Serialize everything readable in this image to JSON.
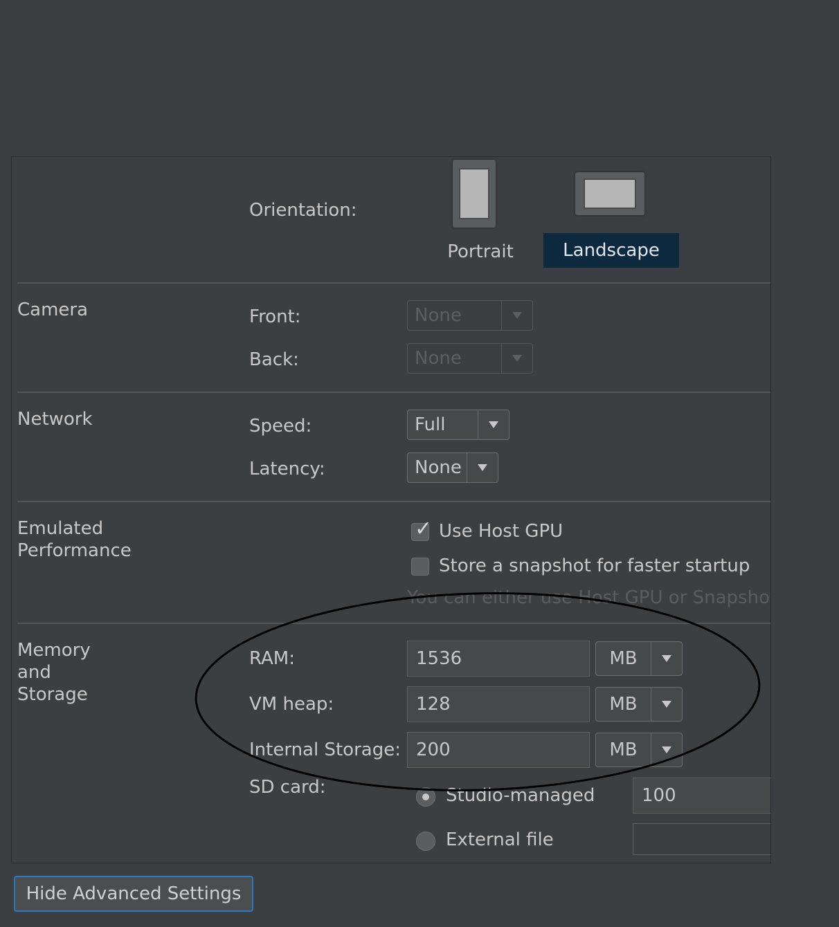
{
  "orientation": {
    "label": "Orientation:",
    "portrait_label": "Portrait",
    "landscape_label": "Landscape",
    "selected": "Landscape"
  },
  "camera": {
    "section": "Camera",
    "front_label": "Front:",
    "front_value": "None",
    "back_label": "Back:",
    "back_value": "None"
  },
  "network": {
    "section": "Network",
    "speed_label": "Speed:",
    "speed_value": "Full",
    "latency_label": "Latency:",
    "latency_value": "None"
  },
  "performance": {
    "section_line1": "Emulated",
    "section_line2": "Performance",
    "host_gpu_label": "Use Host GPU",
    "host_gpu_checked": true,
    "snapshot_label": "Store a snapshot for faster startup",
    "snapshot_checked": false,
    "hint": "You can either use Host GPU or Snapshots"
  },
  "memory": {
    "section_line1": "Memory",
    "section_line2": "and",
    "section_line3": "Storage",
    "ram_label": "RAM:",
    "ram_value": "1536",
    "ram_unit": "MB",
    "vmheap_label": "VM heap:",
    "vmheap_value": "128",
    "vmheap_unit": "MB",
    "internal_label": "Internal Storage:",
    "internal_value": "200",
    "internal_unit": "MB",
    "sdcard_label": "SD card:",
    "studio_managed_label": "Studio-managed",
    "studio_managed_value": "100",
    "external_file_label": "External file",
    "external_file_value": ""
  },
  "footer": {
    "hide_advanced_label": "Hide Advanced Settings"
  },
  "colors": {
    "background": "#3c3f41",
    "selection": "#0d293e",
    "focus_border": "#2a78c4",
    "annotation": "#000000"
  }
}
